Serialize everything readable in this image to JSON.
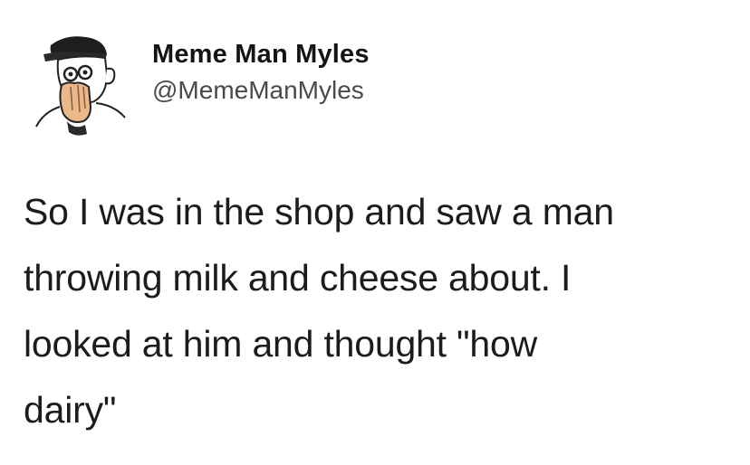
{
  "tweet": {
    "author": {
      "display_name": "Meme Man Myles",
      "handle": "@MemeManMyles",
      "avatar_icon": "meme-man-avatar-icon"
    },
    "text_lines": [
      "So I was in the shop and saw a man",
      "throwing milk and cheese about. I",
      "looked at him and thought \"how",
      "dairy\""
    ]
  }
}
